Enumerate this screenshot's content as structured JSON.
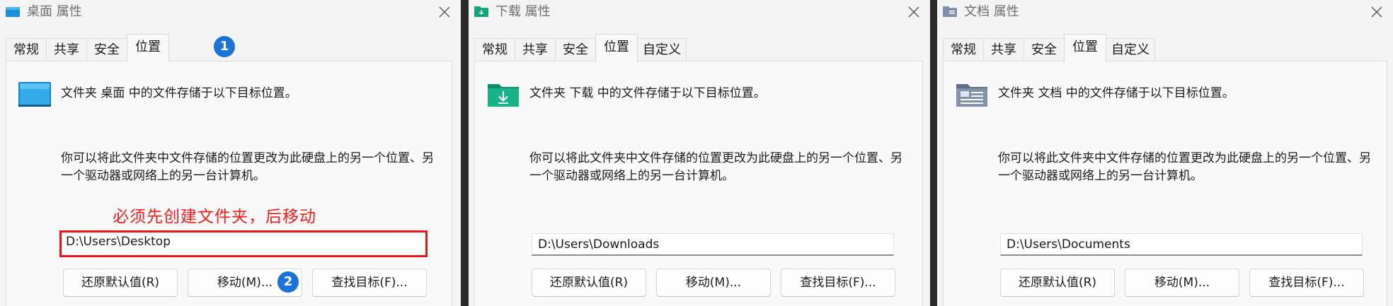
{
  "colors": {
    "annotation": "#ff1a1a",
    "highlight_border": "#e8161b",
    "badge": "#1a73d9"
  },
  "dialogs": [
    {
      "title": "桌面 属性",
      "icon": "desktop-folder-icon",
      "tabs": [
        {
          "label": "常规",
          "active": false
        },
        {
          "label": "共享",
          "active": false
        },
        {
          "label": "安全",
          "active": false
        },
        {
          "label": "位置",
          "active": true
        }
      ],
      "header": "文件夹 桌面 中的文件存储于以下目标位置。",
      "description": "你可以将此文件夹中文件存储的位置更改为此硬盘上的另一个位置、另一个驱动器或网络上的另一台计算机。",
      "path": "D:\\Users\\Desktop",
      "buttons": {
        "restore": "还原默认值(R)",
        "move": "移动(M)...",
        "find": "查找目标(F)..."
      },
      "annotation": "必须先创建文件夹，后移动",
      "badges": [
        "1",
        "2"
      ]
    },
    {
      "title": "下载 属性",
      "icon": "downloads-folder-icon",
      "tabs": [
        {
          "label": "常规",
          "active": false
        },
        {
          "label": "共享",
          "active": false
        },
        {
          "label": "安全",
          "active": false
        },
        {
          "label": "位置",
          "active": true
        },
        {
          "label": "自定义",
          "active": false
        }
      ],
      "header": "文件夹 下载 中的文件存储于以下目标位置。",
      "description": "你可以将此文件夹中文件存储的位置更改为此硬盘上的另一个位置、另一个驱动器或网络上的另一台计算机。",
      "path": "D:\\Users\\Downloads",
      "buttons": {
        "restore": "还原默认值(R)",
        "move": "移动(M)...",
        "find": "查找目标(F)..."
      }
    },
    {
      "title": "文档 属性",
      "icon": "documents-folder-icon",
      "tabs": [
        {
          "label": "常规",
          "active": false
        },
        {
          "label": "共享",
          "active": false
        },
        {
          "label": "安全",
          "active": false
        },
        {
          "label": "位置",
          "active": true
        },
        {
          "label": "自定义",
          "active": false
        }
      ],
      "header": "文件夹 文档 中的文件存储于以下目标位置。",
      "description": "你可以将此文件夹中文件存储的位置更改为此硬盘上的另一个位置、另一个驱动器或网络上的另一台计算机。",
      "path": "D:\\Users\\Documents",
      "buttons": {
        "restore": "还原默认值(R)",
        "move": "移动(M)...",
        "find": "查找目标(F)..."
      }
    }
  ]
}
